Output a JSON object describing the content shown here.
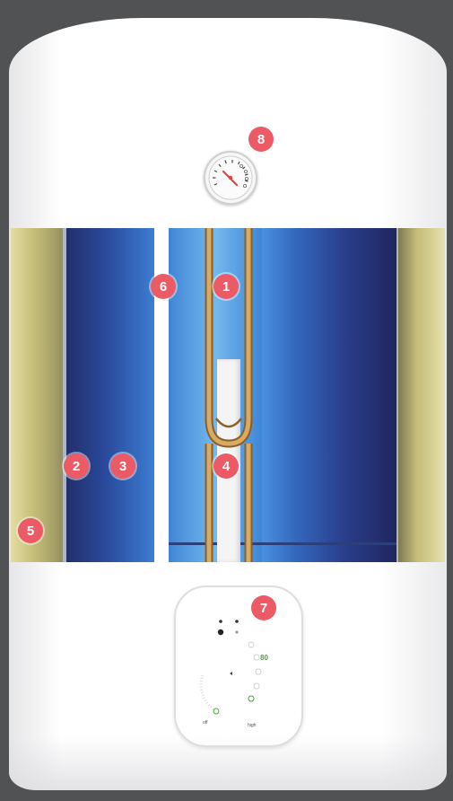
{
  "callouts": [
    {
      "id": "callout-1",
      "label": "1"
    },
    {
      "id": "callout-2",
      "label": "2"
    },
    {
      "id": "callout-3",
      "label": "3"
    },
    {
      "id": "callout-4",
      "label": "4"
    },
    {
      "id": "callout-5",
      "label": "5"
    },
    {
      "id": "callout-6",
      "label": "6"
    },
    {
      "id": "callout-7",
      "label": "7"
    },
    {
      "id": "callout-8",
      "label": "8"
    }
  ],
  "control_panel": {
    "dial_max_label": "80",
    "dial_low_label": "off",
    "dial_high_label": "high"
  },
  "colors": {
    "callout": "#ec5a66",
    "water_dark": "#222f6c",
    "water_light": "#74b8ec",
    "insulation": "#c7c07a",
    "copper_tube": "#b5894a",
    "gauge_needle": "#e0473a",
    "dial_accent": "#49a838"
  }
}
